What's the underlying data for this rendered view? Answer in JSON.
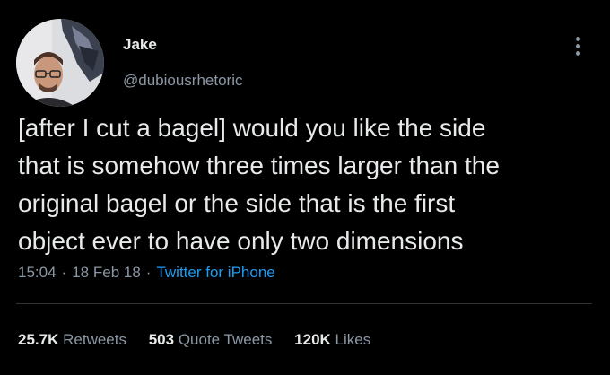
{
  "tweet": {
    "author": {
      "name": "Jake",
      "handle": "@dubiousrhetoric"
    },
    "text": "[after I cut a bagel] would you like the side\nthat is somehow three times larger than the\noriginal bagel or the side that is the first\nobject ever to have only two dimensions",
    "time": "15:04",
    "date": "18 Feb 18",
    "separator": "·",
    "source": "Twitter for iPhone",
    "stats": {
      "retweets_count": "25.7K",
      "retweets_label": "Retweets",
      "quote_tweets_count": "503",
      "quote_tweets_label": "Quote Tweets",
      "likes_count": "120K",
      "likes_label": "Likes"
    }
  },
  "icons": {
    "more": "more-vertical-icon"
  },
  "colors": {
    "background": "#000000",
    "text": "#e7e9ea",
    "secondary": "#8b98a5",
    "link": "#1d9bf0",
    "divider": "#2f3336"
  }
}
